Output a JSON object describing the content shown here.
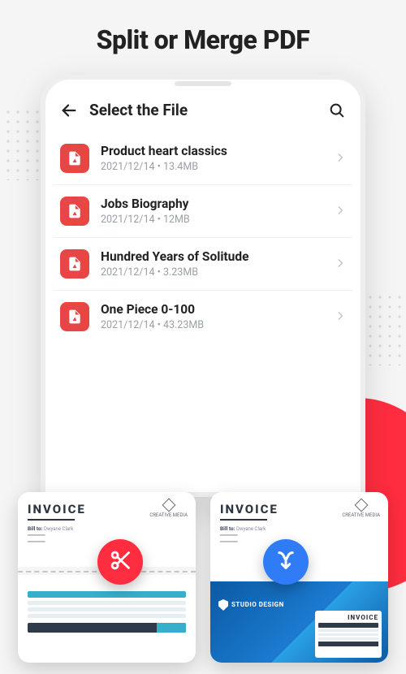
{
  "hero": {
    "title": "Split or Merge PDF"
  },
  "screen": {
    "back_label": "Back",
    "title": "Select the File",
    "search_label": "Search"
  },
  "files": [
    {
      "name": "Product heart classics",
      "date": "2021/12/14",
      "size": "13.4MB"
    },
    {
      "name": "Jobs Biography",
      "date": "2021/12/14",
      "size": "12MB"
    },
    {
      "name": "Hundred Years of Solitude",
      "date": "2021/12/14",
      "size": "3.23MB"
    },
    {
      "name": "One Piece 0-100",
      "date": "2021/12/14",
      "size": "43.23MB"
    }
  ],
  "preview": {
    "split": {
      "doc_title": "INVOICE",
      "brand": "CREATIVE MEDIA",
      "bill_to_label": "Bill to:",
      "bill_to_name": "Dwyane Clark",
      "action_label": "Split"
    },
    "merge": {
      "doc_title": "INVOICE",
      "brand": "CREATIVE MEDIA",
      "bill_to_label": "Bill to:",
      "bill_to_name": "Dwyane Clark",
      "studio_label": "STUDIO DESIGN",
      "mini_title": "INVOICE",
      "action_label": "Merge"
    }
  }
}
